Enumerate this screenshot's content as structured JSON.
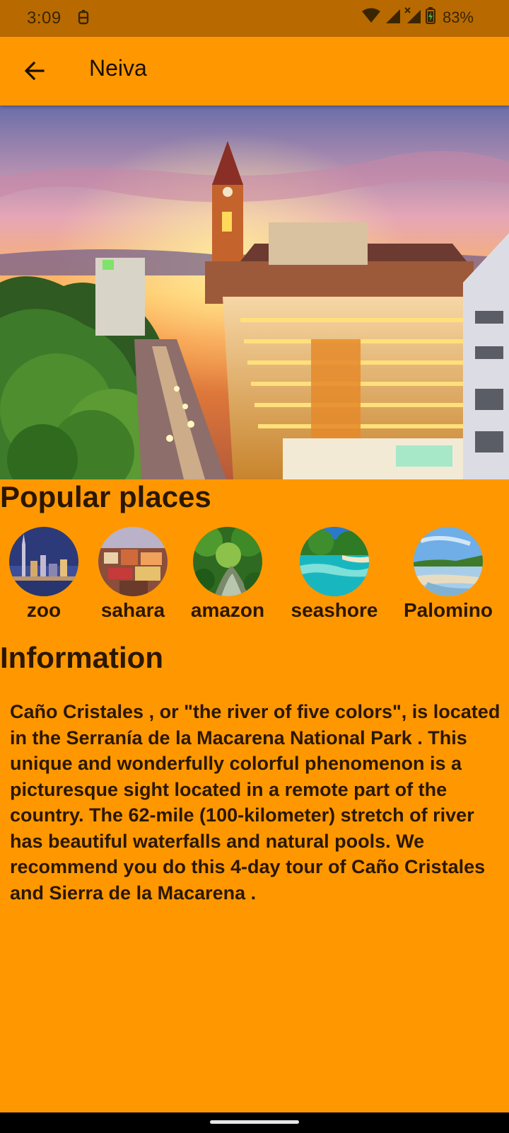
{
  "status_bar": {
    "time": "3:09",
    "battery": "83%",
    "icons": [
      "notification-icon",
      "wifi-icon",
      "signal-icon",
      "signal-no-service-icon",
      "battery-charging-icon"
    ]
  },
  "app_bar": {
    "title": "Neiva",
    "back_icon": "arrow-left-icon"
  },
  "hero": {
    "image": "city-sunset-photo"
  },
  "popular": {
    "title": "Popular places",
    "items": [
      {
        "label": "zoo",
        "image": "night-city-skyline-photo"
      },
      {
        "label": "sahara",
        "image": "colorful-town-photo"
      },
      {
        "label": "amazon",
        "image": "jungle-river-photo"
      },
      {
        "label": "seashore",
        "image": "tropical-beach-photo"
      },
      {
        "label": "Palomino",
        "image": "river-beach-photo"
      }
    ]
  },
  "information": {
    "title": "Information",
    "text": "Caño Cristales , or \"the river of five colors\", is located in the Serranía de la Macarena National Park . This unique and wonderfully colorful phenomenon is a picturesque sight located in a remote part of the country. The 62-mile (100-kilometer) stretch of river has beautiful waterfalls and natural pools. We recommend you do this 4-day tour of Caño Cristales and Sierra de la Macarena ."
  },
  "colors": {
    "background": "#ff9800",
    "status_bar": "#b86a00",
    "text": "#2b1700"
  }
}
